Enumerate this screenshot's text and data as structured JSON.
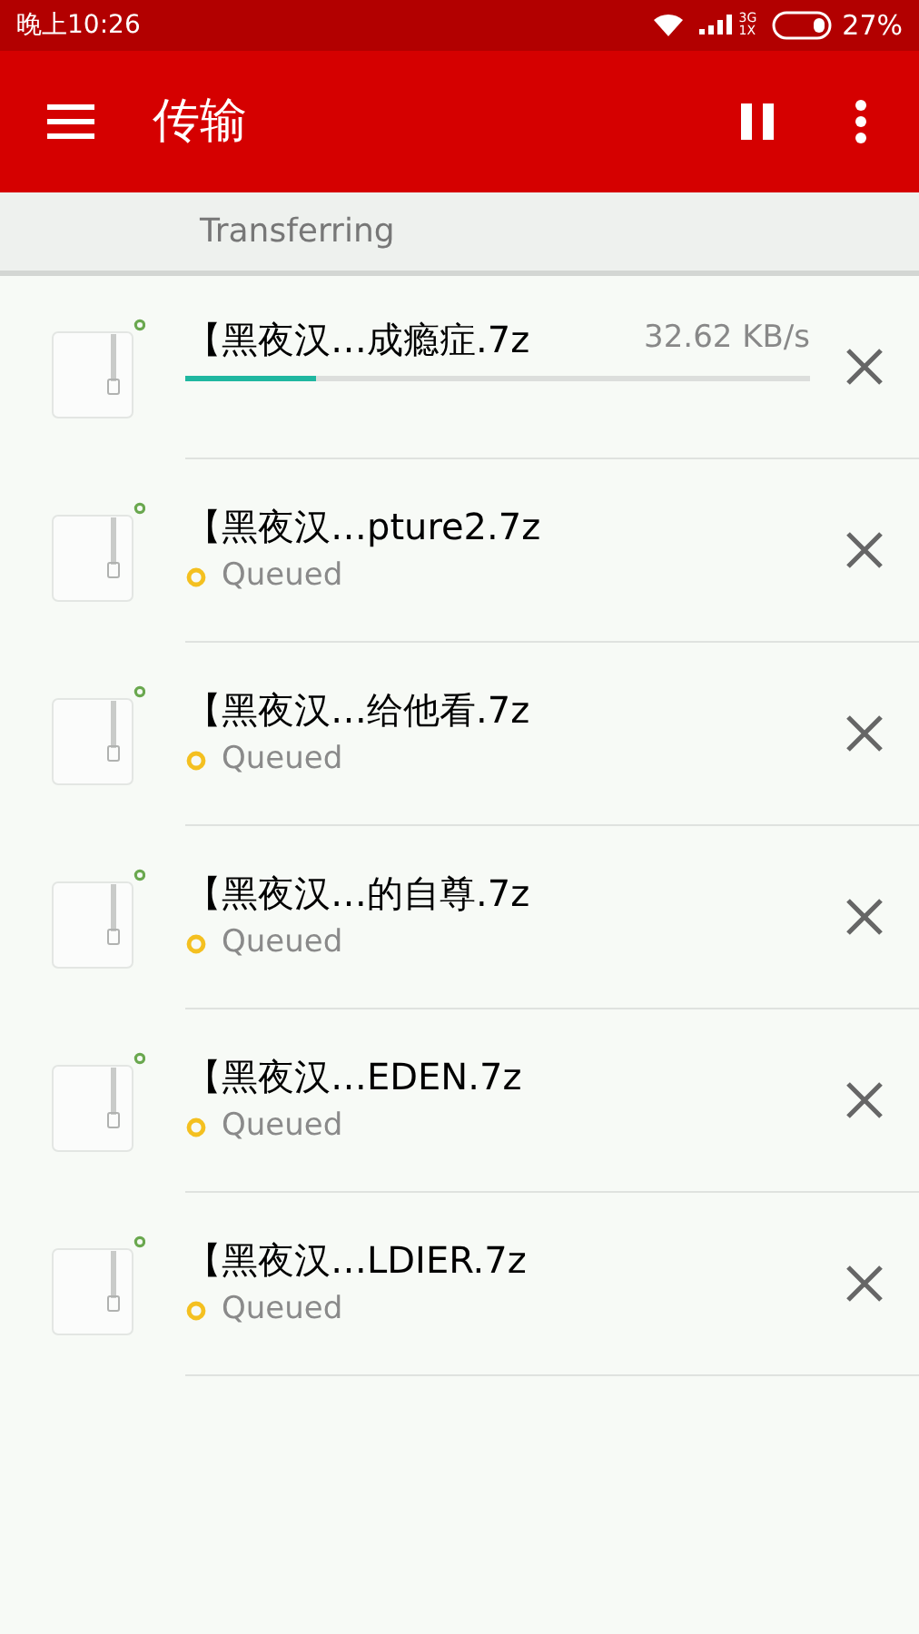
{
  "status_bar": {
    "time": "晚上10:26",
    "network_top": "3G",
    "network_bottom": "1X",
    "battery": "27%"
  },
  "app_bar": {
    "title": "传输"
  },
  "section": {
    "title": "Transferring"
  },
  "transfers": [
    {
      "kind": "active",
      "name": "【黑夜汉…成瘾症.7z",
      "speed": "32.62 KB/s",
      "level": 0.21
    },
    {
      "kind": "queued",
      "name": "【黑夜汉…pture2.7z",
      "status": "Queued"
    },
    {
      "kind": "queued",
      "name": "【黑夜汉…给他看.7z",
      "status": "Queued"
    },
    {
      "kind": "queued",
      "name": "【黑夜汉…的自尊.7z",
      "status": "Queued"
    },
    {
      "kind": "queued",
      "name": "【黑夜汉…EDEN.7z",
      "status": "Queued"
    },
    {
      "kind": "queued",
      "name": "【黑夜汉…LDIER.7z",
      "status": "Queued"
    }
  ]
}
